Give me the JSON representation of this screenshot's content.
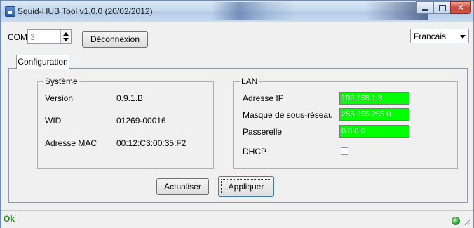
{
  "window": {
    "title": "Squid-HUB Tool v1.0.0 (20/02/2012)"
  },
  "connection": {
    "com_label": "COM",
    "com_value": "3",
    "disconnect_label": "Déconnexion",
    "language_selected": "Francais"
  },
  "tabs": [
    {
      "label": "Configuration",
      "active": true
    }
  ],
  "system": {
    "legend": "Système",
    "version_label": "Version",
    "version_value": "0.9.1.B",
    "wid_label": "WID",
    "wid_value": "01269-00016",
    "mac_label": "Adresse MAC",
    "mac_value": "00:12:C3:00:35:F2"
  },
  "lan": {
    "legend": "LAN",
    "ip_label": "Adresse IP",
    "ip_value": "192.168.1.8",
    "mask_label": "Masque de sous-réseau",
    "mask_value": "255.255.255.0",
    "gateway_label": "Passerelle",
    "gateway_value": "0.0.0.0",
    "dhcp_label": "DHCP",
    "dhcp_checked": false,
    "field_color": "#00ff00"
  },
  "actions": {
    "refresh_label": "Actualiser",
    "apply_label": "Appliquer"
  },
  "status": {
    "text": "Ok",
    "led_color": "#1c9a1c"
  }
}
